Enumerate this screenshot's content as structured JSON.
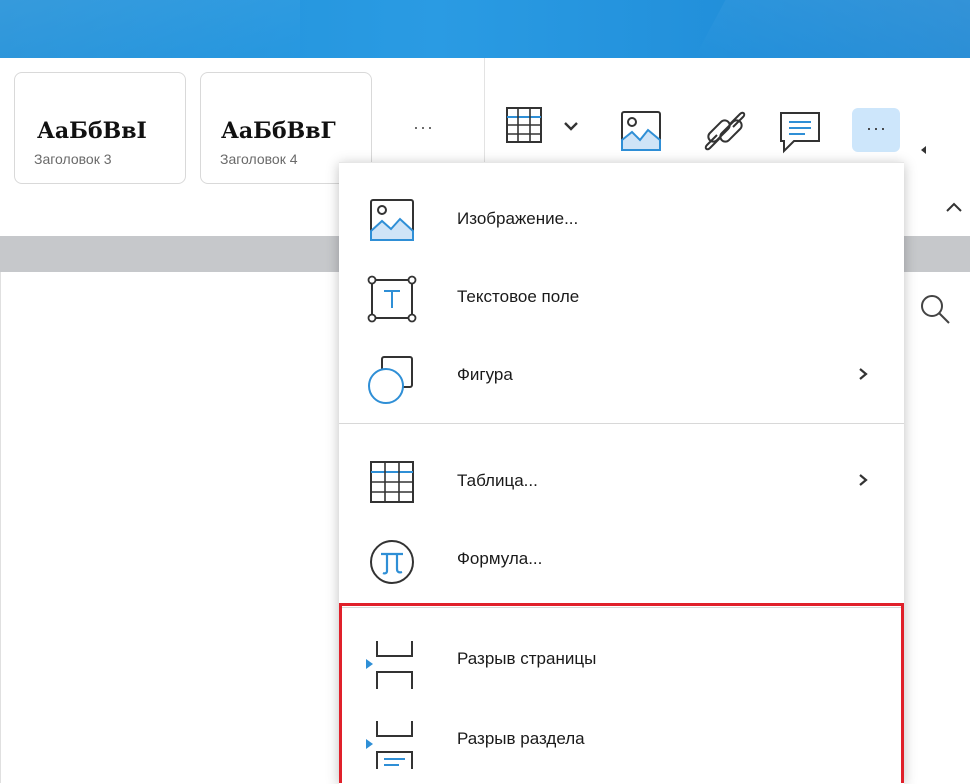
{
  "ribbon": {
    "styles": [
      {
        "sample": "АаБбВвI",
        "name": "Заголовок 3"
      },
      {
        "sample": "АаБбВвГ",
        "name": "Заголовок 4"
      }
    ],
    "styles_more": "···",
    "toolbar_icons": [
      "table-icon",
      "image-icon",
      "link-icon",
      "comment-icon",
      "more-icon"
    ],
    "more_label": "···"
  },
  "menu": {
    "items": [
      {
        "label": "Изображение...",
        "icon": "image-icon",
        "has_submenu": false
      },
      {
        "label": "Текстовое поле",
        "icon": "text-box-icon",
        "has_submenu": false
      },
      {
        "label": "Фигура",
        "icon": "shape-icon",
        "has_submenu": true
      },
      {
        "label": "Таблица...",
        "icon": "table-icon",
        "has_submenu": true
      },
      {
        "label": "Формула...",
        "icon": "formula-icon",
        "has_submenu": false
      },
      {
        "label": "Разрыв страницы",
        "icon": "page-break-icon",
        "has_submenu": false
      },
      {
        "label": "Разрыв раздела",
        "icon": "section-break-icon",
        "has_submenu": false
      }
    ]
  },
  "colors": {
    "accent": "#2a9be3",
    "icon_blue": "#2f8fd6",
    "highlight": "#e0202a",
    "more_button_bg": "#cde6fb"
  }
}
